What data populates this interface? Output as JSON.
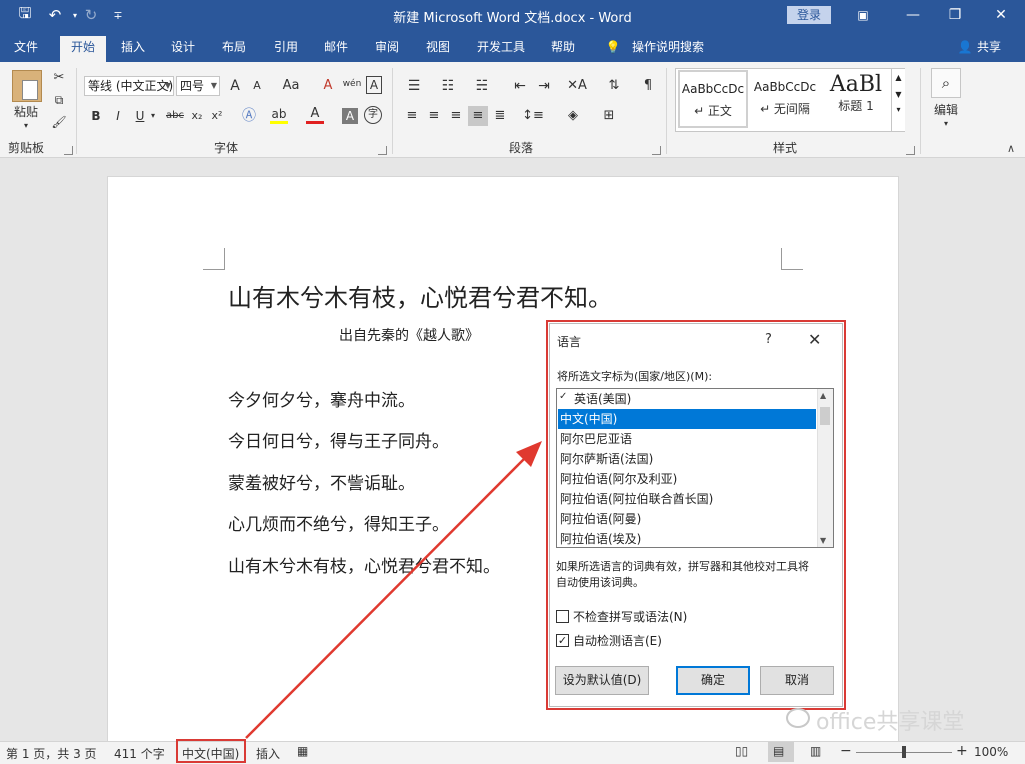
{
  "window": {
    "title": "新建 Microsoft Word 文档.docx - Word",
    "login_label": "登录",
    "minimize": "—",
    "restore": "❐",
    "close": "✕"
  },
  "qat": {
    "save": "🖫",
    "undo": "↶",
    "redo": "↻",
    "customize": "∓"
  },
  "tabs": [
    "文件",
    "开始",
    "插入",
    "设计",
    "布局",
    "引用",
    "邮件",
    "审阅",
    "视图",
    "开发工具",
    "帮助"
  ],
  "tell_me": "操作说明搜索",
  "share": "共享",
  "ribbon": {
    "clipboard": {
      "paste": "粘贴",
      "label": "剪贴板"
    },
    "font": {
      "name": "等线 (中文正文)",
      "size": "四号",
      "label": "字体",
      "bold": "B",
      "italic": "I",
      "underline": "U",
      "strike": "abc",
      "sub": "x₂",
      "sup": "x²",
      "grow": "A",
      "shrink": "A",
      "case": "Aa",
      "clear": "A",
      "border": "A",
      "circle": "字",
      "phonetic": "wén"
    },
    "paragraph": {
      "label": "段落"
    },
    "styles": {
      "label": "样式",
      "items": [
        {
          "preview": "AaBbCcDc",
          "name": "↵ 正文"
        },
        {
          "preview": "AaBbCcDc",
          "name": "↵ 无间隔"
        },
        {
          "preview": "AaBl",
          "name": "标题 1"
        }
      ]
    },
    "editing": {
      "label": "编辑"
    }
  },
  "document": {
    "title": "山有木兮木有枝，心悦君兮君不知。",
    "subtitle": "出自先秦的《越人歌》",
    "lines": [
      "今夕何夕兮，搴舟中流。",
      "今日何日兮，得与王子同舟。",
      "蒙羞被好兮，不訾诟耻。",
      "心几烦而不绝兮，得知王子。",
      "山有木兮木有枝，心悦君兮君不知。"
    ]
  },
  "dialog": {
    "title": "语言",
    "help": "?",
    "close": "✕",
    "list_label": "将所选文字标为(国家/地区)(M):",
    "languages": [
      "英语(美国)",
      "中文(中国)",
      "阿尔巴尼亚语",
      "阿尔萨斯语(法国)",
      "阿拉伯语(阿尔及利亚)",
      "阿拉伯语(阿拉伯联合酋长国)",
      "阿拉伯语(阿曼)",
      "阿拉伯语(埃及)"
    ],
    "selected_index": 1,
    "info": [
      "如果所选语言的词典有效，拼写器和其他校对工具将",
      "自动使用该词典。"
    ],
    "no_proof": {
      "label": "不检查拼写或语法(N)",
      "checked": false
    },
    "auto_detect": {
      "label": "自动检测语言(E)",
      "checked": true
    },
    "buttons": {
      "default": "设为默认值(D)",
      "ok": "确定",
      "cancel": "取消"
    }
  },
  "status": {
    "page": "第 1 页，共 3 页",
    "words": "411 个字",
    "language": "中文(中国)",
    "insert": "插入",
    "zoom": "100%",
    "zoom_level": 1.0
  },
  "watermark": "office共享课堂",
  "colors": {
    "word_blue": "#2b579a",
    "highlight_red": "#d93a35",
    "select_blue": "#0078d7"
  }
}
